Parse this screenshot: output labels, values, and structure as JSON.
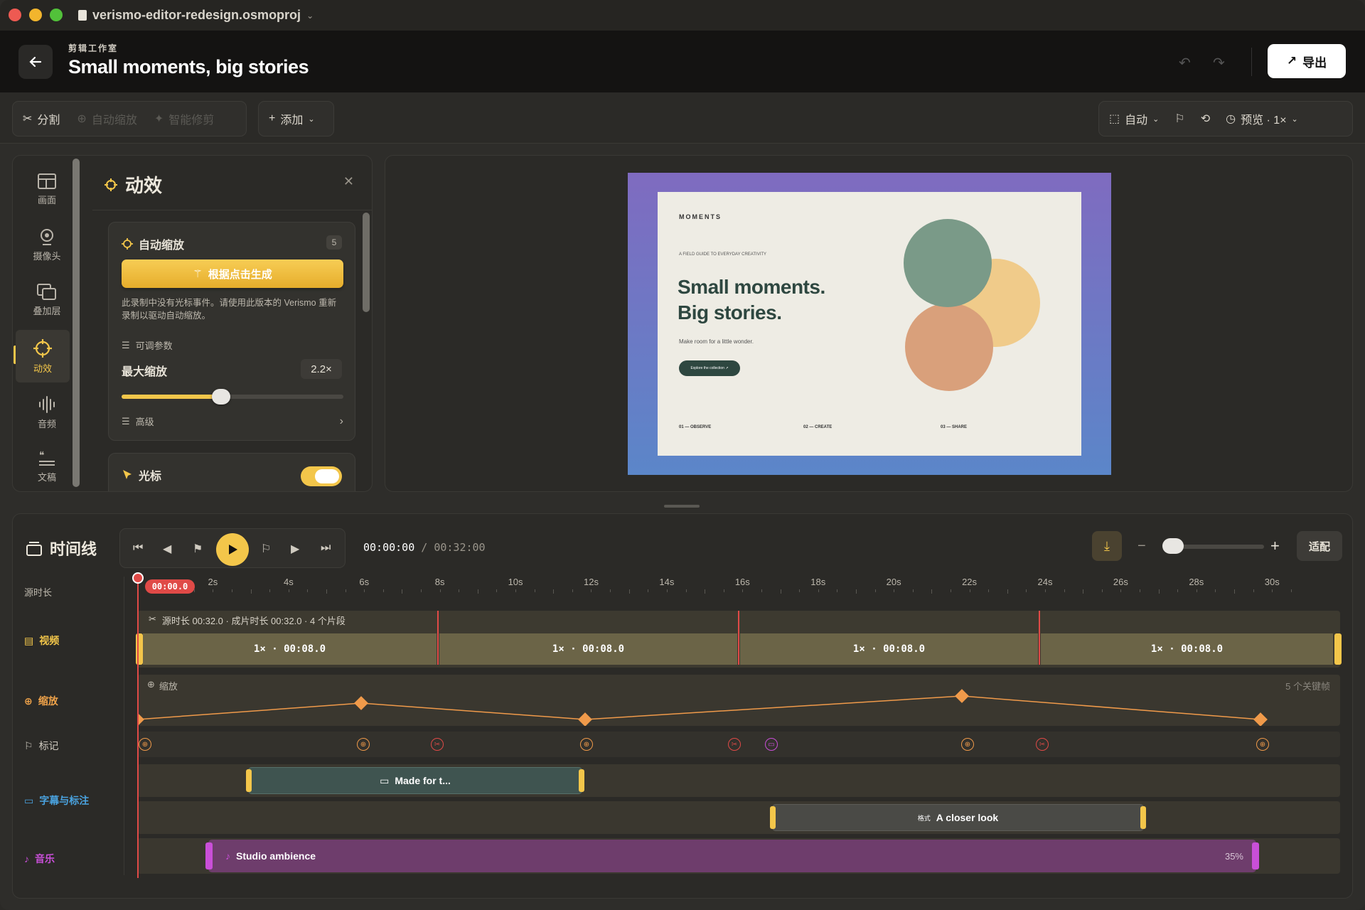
{
  "window": {
    "file_name": "verismo-editor-redesign.osmoproj"
  },
  "header": {
    "subtitle": "剪辑工作室",
    "title": "Small moments, big stories",
    "export_label": "导出"
  },
  "toolbar": {
    "split": "分割",
    "auto_zoom": "自动缩放",
    "smart_trim": "智能修剪",
    "add": "添加",
    "auto": "自动",
    "preview": "预览 · 1×"
  },
  "rail": [
    {
      "label": "画面",
      "icon": "layout-icon"
    },
    {
      "label": "摄像头",
      "icon": "camera-icon"
    },
    {
      "label": "叠加层",
      "icon": "overlay-icon"
    },
    {
      "label": "动效",
      "icon": "crosshair-icon",
      "active": true
    },
    {
      "label": "音频",
      "icon": "waveform-icon"
    },
    {
      "label": "文稿",
      "icon": "quote-icon"
    }
  ],
  "effects": {
    "title": "动效",
    "auto_zoom": {
      "title": "自动缩放",
      "count": "5",
      "generate_label": "根据点击生成",
      "hint": "此录制中没有光标事件。请使用此版本的 Verismo 重新录制以驱动自动缩放。",
      "params_label": "可调参数",
      "max_zoom_label": "最大缩放",
      "max_zoom_value": "2.2×",
      "max_zoom_fraction": 0.45,
      "advanced_label": "高级"
    },
    "cursor": {
      "title": "光标",
      "enabled": true
    }
  },
  "slide": {
    "brand": "MOMENTS",
    "kicker": "A FIELD GUIDE TO EVERYDAY CREATIVITY",
    "headline_1": "Small moments.",
    "headline_2": "Big stories.",
    "tagline": "Make room for a little wonder.",
    "cta": "Explore the collection ↗",
    "steps": [
      "01 — OBSERVE",
      "02 — CREATE",
      "03 — SHARE"
    ],
    "colors": {
      "green": "#7a9a88",
      "yellow": "#f0cb8a",
      "orange": "#d9a07b"
    }
  },
  "timeline": {
    "title": "时间线",
    "current": "00:00:00",
    "total": "00:32:00",
    "fit_label": "适配",
    "playhead_label": "00:00.0",
    "ruler_label": "源时长",
    "ticks": [
      "2s",
      "4s",
      "6s",
      "8s",
      "10s",
      "12s",
      "14s",
      "16s",
      "18s",
      "20s",
      "22s",
      "24s",
      "26s",
      "28s",
      "30s"
    ],
    "tracks": {
      "video": "视频",
      "zoom": "缩放",
      "markers": "标记",
      "captions": "字幕与标注",
      "music": "音乐"
    },
    "video_info": "源时长 00:32.0 · 成片时长 00:32.0 · 4 个片段",
    "segments": [
      "1× · 00:08.0",
      "1× · 00:08.0",
      "1× · 00:08.0",
      "1× · 00:08.0"
    ],
    "zoom_label": "缩放",
    "keyframes_label": "5 个关键帧",
    "captions": [
      {
        "text": "Made for t..."
      },
      {
        "prefix": "格式",
        "text": "A closer look"
      }
    ],
    "music": {
      "name": "Studio ambience",
      "volume": "35%"
    }
  },
  "colors": {
    "accent": "#f3c64a",
    "playhead": "#e04a47",
    "caption": "#4aa3e0",
    "music": "#c94fd8"
  }
}
